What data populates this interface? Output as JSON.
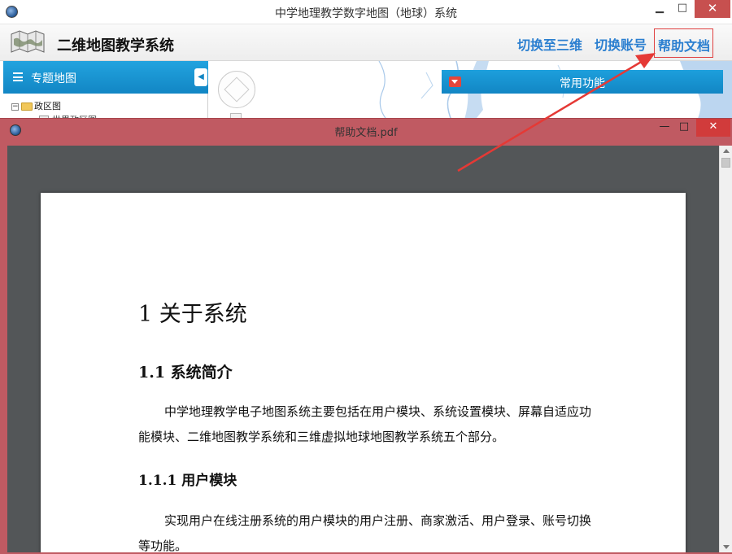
{
  "main_window": {
    "title": "中学地理教学数字地图（地球）系统",
    "controls": {
      "minimize": "▁",
      "maximize": "□",
      "close": "✕"
    }
  },
  "header": {
    "app_name": "二维地图教学系统",
    "nav": {
      "switch_3d": "切换至三维",
      "switch_account": "切换账号",
      "help_doc": "帮助文档"
    }
  },
  "sidebar": {
    "title": "专题地图",
    "collapse_glyph": "◀",
    "tree": [
      {
        "expander": "−",
        "label": "政区图"
      },
      {
        "label": "世界政区图"
      }
    ]
  },
  "function_panel": {
    "title": "常用功能"
  },
  "pdf_window": {
    "title": "帮助文档.pdf",
    "controls": {
      "minimize": "—",
      "maximize": "□",
      "close": "✕"
    }
  },
  "document": {
    "h1": "1 关于系统",
    "h2": "1.1  系统简介",
    "p1": "中学地理教学电子地图系统主要包括在用户模块、系统设置模块、屏幕自适应功能模块、二维地图教学系统和三维虚拟地球地图教学系统五个部分。",
    "h3": "1.1.1   用户模块",
    "p2": "实现用户在线注册系统的用户模块的用户注册、商家激活、用户登录、账号切换等功能。"
  },
  "colors": {
    "accent_blue": "#1286c4",
    "link_blue": "#2b7fd0",
    "annotation_red": "#e04040",
    "pdf_frame": "#c05a62"
  }
}
